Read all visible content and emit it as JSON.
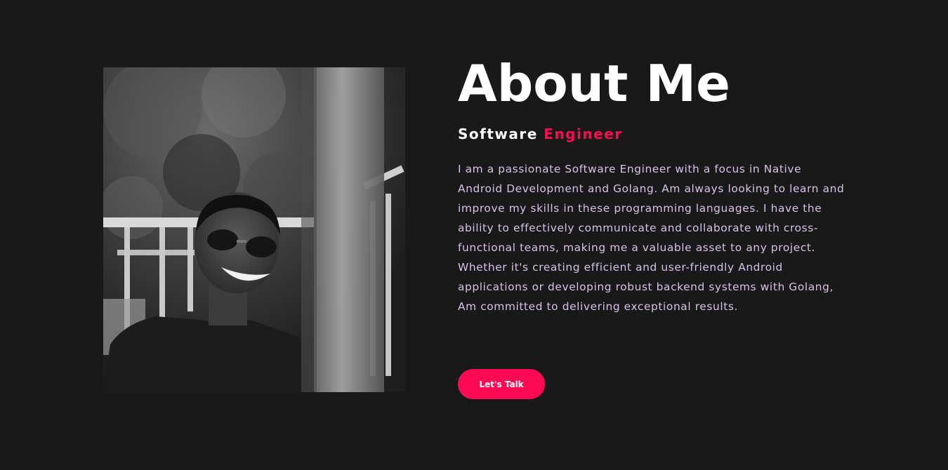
{
  "about": {
    "title": "About Me",
    "subtitle_main": "Software",
    "subtitle_accent": "Engineer",
    "bio": "I am a passionate Software Engineer with a focus in Native Android Development and Golang. Am always looking to learn and improve my skills in these programming languages. I have the ability to effectively communicate and collaborate with cross-functional teams, making me a valuable asset to any project. Whether it's creating efficient and user-friendly Android applications or developing robust backend systems with Golang, Am committed to delivering exceptional results.",
    "cta_label": "Let's Talk"
  },
  "colors": {
    "background": "#191919",
    "accent": "#ff0a54",
    "heading": "#ffffff",
    "body_text": "#d8c2e6"
  }
}
